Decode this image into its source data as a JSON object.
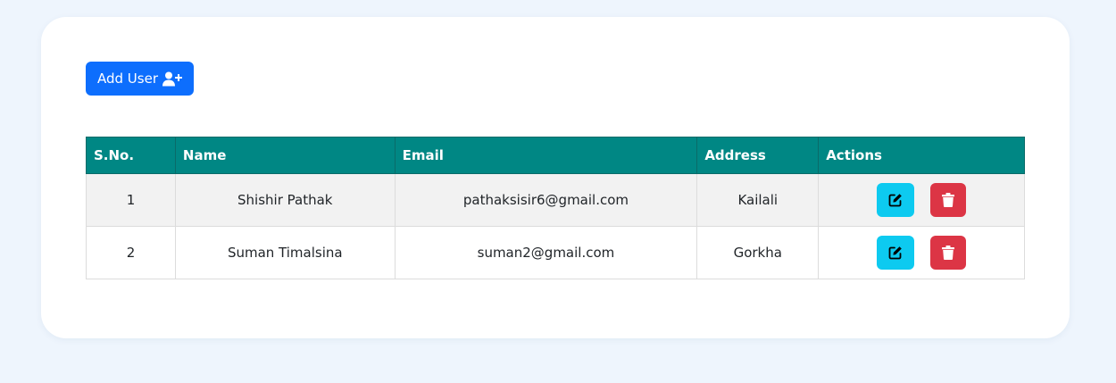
{
  "toolbar": {
    "add_user_label": "Add User",
    "add_user_icon": "user-plus-icon",
    "add_user_color": "#0d6efd"
  },
  "table": {
    "header_color": "#008784",
    "columns": [
      "S.No.",
      "Name",
      "Email",
      "Address",
      "Actions"
    ],
    "rows": [
      {
        "sno": "1",
        "name": "Shishir Pathak",
        "email": "pathaksisir6@gmail.com",
        "address": "Kailali"
      },
      {
        "sno": "2",
        "name": "Suman Timalsina",
        "email": "suman2@gmail.com",
        "address": "Gorkha"
      }
    ],
    "row_actions": [
      {
        "icon": "edit-icon",
        "color": "#0dcaf0"
      },
      {
        "icon": "trash-icon",
        "color": "#dc3545"
      }
    ]
  }
}
